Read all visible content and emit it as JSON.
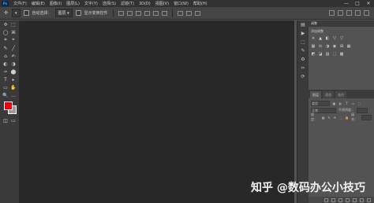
{
  "app": {
    "logo": "Ps"
  },
  "menubar": {
    "items": [
      "文件(F)",
      "编辑(E)",
      "图像(I)",
      "图层(L)",
      "文字(Y)",
      "选择(S)",
      "滤镜(T)",
      "3D(D)",
      "视图(V)",
      "窗口(W)",
      "帮助(H)"
    ],
    "window_controls": [
      "—",
      "□",
      "✕"
    ]
  },
  "options_bar": {
    "auto_select_label": "自动选择：",
    "layer_dropdown": "图层",
    "show_transform_label": "显示变换控件"
  },
  "tools": {
    "rows": [
      [
        "✣",
        "⬚"
      ],
      [
        "◯",
        "⌘"
      ],
      [
        "⌗",
        "⌖"
      ],
      [
        "✎",
        "╱"
      ],
      [
        "⌂",
        "✍"
      ],
      [
        "◐",
        "◑"
      ],
      [
        "✑",
        "⬤"
      ],
      [
        "T",
        "▸"
      ],
      [
        "▭",
        "✋"
      ],
      [
        "🔍",
        "…"
      ]
    ],
    "foreground_color": "#e8000f",
    "background_color": "#9a9a9a"
  },
  "icon_strip": {
    "icons": [
      "▤",
      "▶",
      "⬚",
      "✎",
      "⚙",
      "✂",
      "⟳"
    ]
  },
  "adjustments": {
    "tab": "调整",
    "subtitle": "添加调整",
    "row1": [
      "☀",
      "▲",
      "◧",
      "▽",
      "▽"
    ],
    "row2": [
      "▦",
      "⚖",
      "◑",
      "◉",
      "⊞",
      "▦"
    ],
    "row3": [
      "◩",
      "◪",
      "▨",
      "⬚",
      "▩"
    ]
  },
  "layers": {
    "tabs": [
      "图层",
      "通道",
      "路径"
    ],
    "kind_label": "类型",
    "mode_label": "正常",
    "opacity_label": "不透明度：",
    "lock_label": "锁定：",
    "fill_label": "填充："
  },
  "watermark": {
    "text": "知乎 @数码办公小技巧"
  }
}
